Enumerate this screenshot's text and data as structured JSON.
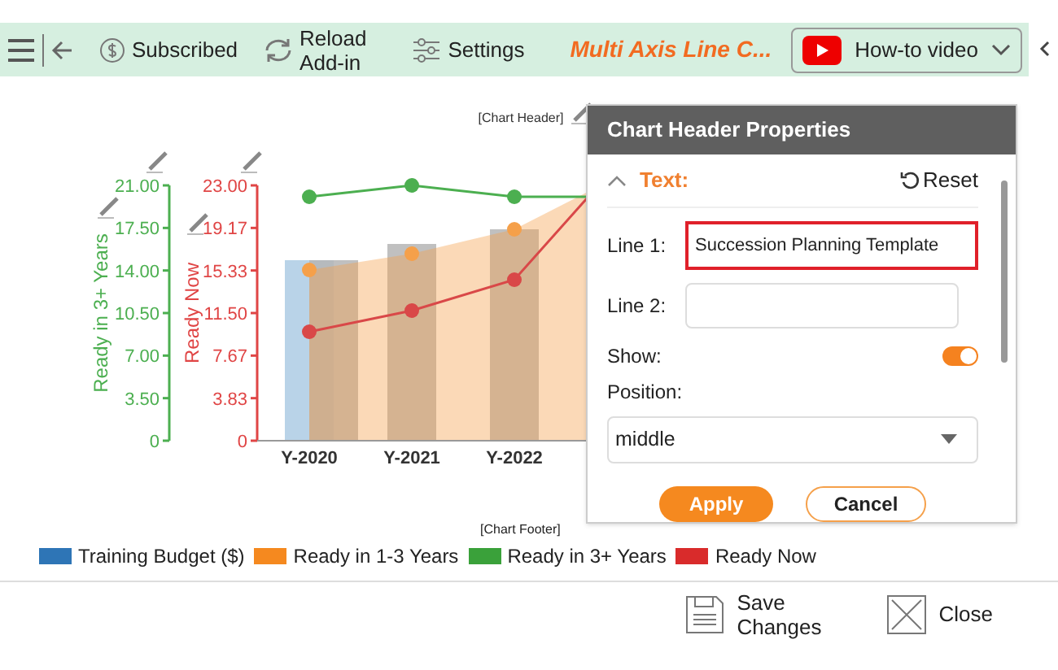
{
  "toolbar": {
    "subscribed": "Subscribed",
    "reload": [
      "Reload",
      "Add-in"
    ],
    "settings": "Settings",
    "title": "Multi Axis Line C...",
    "video": "How-to video"
  },
  "chart": {
    "header": "[Chart Header]",
    "footer": "[Chart Footer]",
    "categories": [
      "Y-2020",
      "Y-2021",
      "Y-2022"
    ],
    "axes": [
      {
        "label": "Ready in 3+ Years",
        "color": "#4caf50",
        "ticks": [
          "21.00",
          "17.50",
          "14.00",
          "10.50",
          "7.00",
          "3.50",
          "0"
        ]
      },
      {
        "label": "Ready Now",
        "color": "#e04545",
        "ticks": [
          "23.00",
          "19.17",
          "15.33",
          "11.50",
          "7.67",
          "3.83",
          "0"
        ]
      }
    ],
    "legend": [
      {
        "label": "Training Budget ($)",
        "color": "#2e75b6"
      },
      {
        "label": "Ready in 1-3 Years",
        "color": "#f5891f"
      },
      {
        "label": "Ready in 3+ Years",
        "color": "#3aa13a"
      },
      {
        "label": "Ready Now",
        "color": "#d92b2b"
      }
    ]
  },
  "panel": {
    "title": "Chart Header Properties",
    "section": {
      "label": "Text:",
      "expanded": true
    },
    "reset": "Reset",
    "line1": {
      "label": "Line 1:",
      "value": "Succession Planning Template"
    },
    "line2": {
      "label": "Line 2:"
    },
    "show": {
      "label": "Show:",
      "on": true
    },
    "position": {
      "label": "Position:",
      "value": "middle"
    },
    "apply": "Apply",
    "cancel": "Cancel"
  },
  "footer": {
    "save": [
      "Save",
      "Changes"
    ],
    "close": "Close"
  }
}
